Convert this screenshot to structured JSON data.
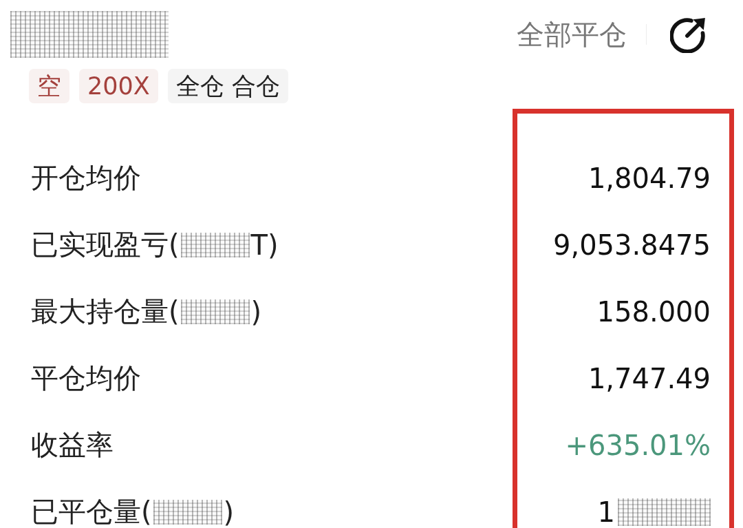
{
  "header": {
    "title_masked": true,
    "close_all_label": "全部平仓"
  },
  "tags": [
    {
      "text": "空",
      "kind": "short"
    },
    {
      "text": "200X",
      "kind": "short"
    },
    {
      "text": "全仓 合仓",
      "kind": "plain"
    }
  ],
  "rows": [
    {
      "label": "开仓均价",
      "label_masked": false,
      "value": "1,804.79",
      "value_masked": false,
      "gain": false
    },
    {
      "label": "已实现盈亏(",
      "label_masked": true,
      "label_tail": "T)",
      "value": "9,053.8475",
      "value_masked": false,
      "gain": false
    },
    {
      "label": "最大持仓量(",
      "label_masked": true,
      "label_tail": ")",
      "value": "158.000",
      "value_masked": false,
      "gain": false
    },
    {
      "label": "平仓均价",
      "label_masked": false,
      "value": "1,747.49",
      "value_masked": false,
      "gain": false
    },
    {
      "label": "收益率",
      "label_masked": false,
      "value": "+635.01%",
      "value_masked": false,
      "gain": true
    },
    {
      "label": "已平仓量(",
      "label_masked": true,
      "label_tail": ")",
      "value": "1",
      "value_masked": true,
      "gain": false
    }
  ]
}
